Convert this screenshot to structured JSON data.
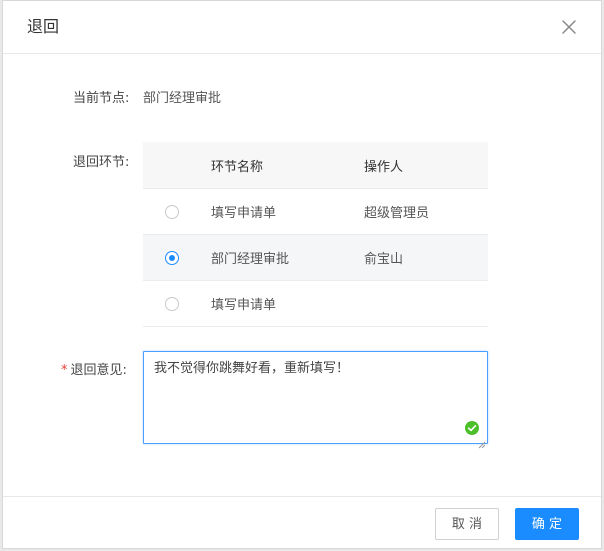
{
  "dialog": {
    "title": "退回"
  },
  "current_node": {
    "label": "当前节点:",
    "value": "部门经理审批"
  },
  "return_step": {
    "label": "退回环节:",
    "columns": [
      "环节名称",
      "操作人"
    ],
    "rows": [
      {
        "name": "填写申请单",
        "operator": "超级管理员",
        "selected": false
      },
      {
        "name": "部门经理审批",
        "operator": "俞宝山",
        "selected": true
      },
      {
        "name": "填写申请单",
        "operator": "",
        "selected": false
      }
    ]
  },
  "opinion": {
    "required_mark": "*",
    "label": "退回意见:",
    "value": "我不觉得你跳舞好看，重新填写！"
  },
  "footer": {
    "cancel_label": "取 消",
    "ok_label": "确 定"
  },
  "colors": {
    "primary": "#1a8cff",
    "valid": "#4cbf2a",
    "required": "#e5403a"
  }
}
